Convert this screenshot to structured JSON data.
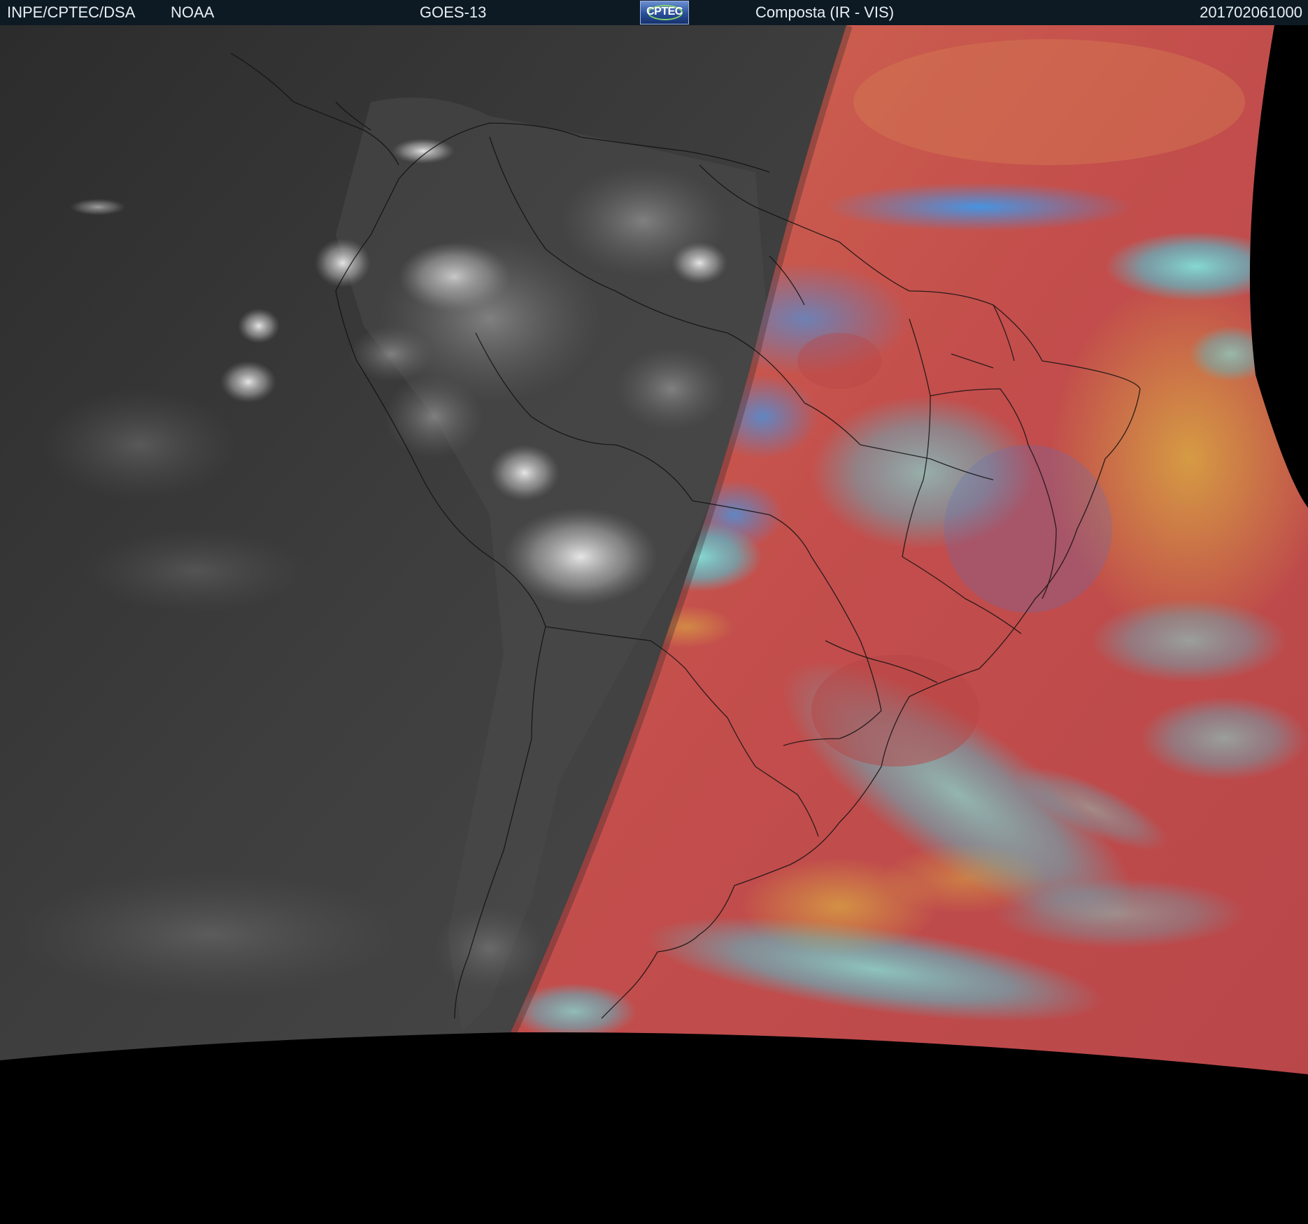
{
  "header": {
    "source": "INPE/CPTEC/DSA",
    "agency": "NOAA",
    "satellite": "GOES-13",
    "logo_text": "CPTEC",
    "product": "Composta (IR - VIS)",
    "timestamp": "201702061000"
  },
  "colors": {
    "header_bg": "#0d1a24",
    "night_side": "#3a3a3a",
    "day_side_base": "#c8504a",
    "cloud_cyan": "#4fd0e0",
    "cloud_yellow": "#d8c040",
    "background": "#000000"
  },
  "icons": {
    "logo": "cptec-logo"
  }
}
